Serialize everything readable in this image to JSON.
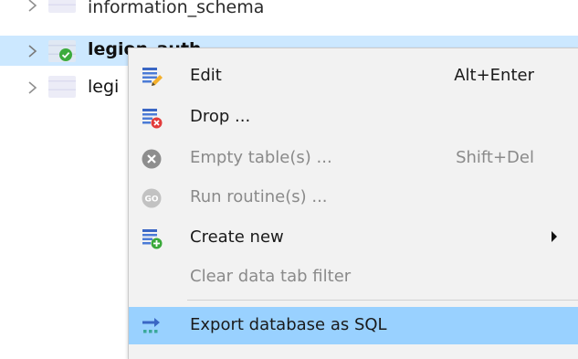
{
  "tree": {
    "rows": [
      {
        "label": "information_schema"
      },
      {
        "label": "legion_auth"
      },
      {
        "label": "legi"
      }
    ]
  },
  "context_menu": {
    "items": [
      {
        "label": "Edit",
        "shortcut": "Alt+Enter",
        "icon": "edit-table-icon"
      },
      {
        "label": "Drop ...",
        "icon": "drop-icon"
      },
      {
        "label": "Empty table(s) ...",
        "shortcut": "Shift+Del",
        "icon": "empty-icon",
        "disabled": true
      },
      {
        "label": "Run routine(s) ...",
        "icon": "run-routine-icon",
        "disabled": true
      },
      {
        "label": "Create new",
        "icon": "create-new-icon",
        "has_submenu": true
      },
      {
        "label": "Clear data tab filter",
        "disabled": true
      },
      {
        "label": "Export database as SQL",
        "icon": "export-sql-icon",
        "highlighted": true
      }
    ]
  },
  "colors": {
    "selected_row": "#cce8ff",
    "menu_background": "#f2f2f2",
    "menu_highlight": "#99d1ff",
    "disabled_text": "#8a8a8a"
  }
}
